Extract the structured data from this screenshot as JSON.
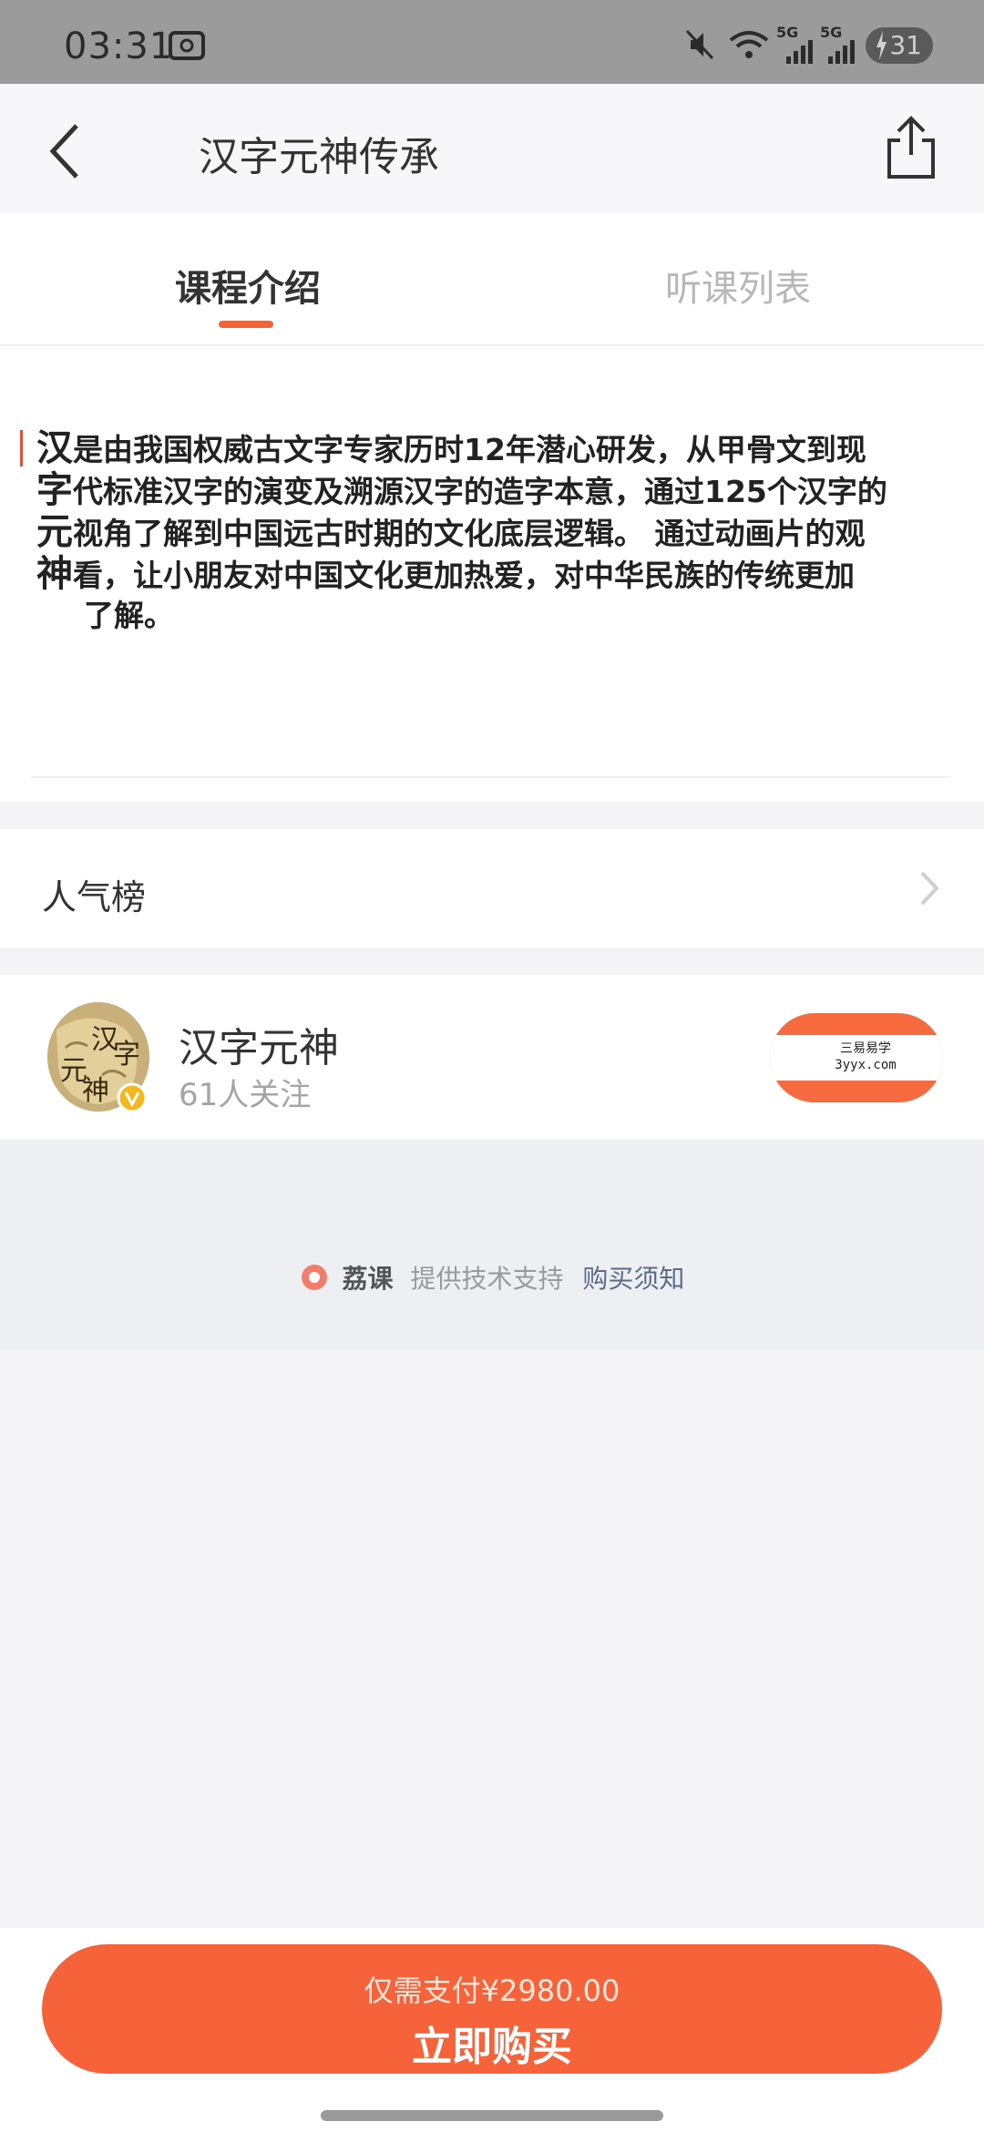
{
  "status_bar": {
    "time": "03:31",
    "signal_5g_a": "5G",
    "signal_5g_b": "5G",
    "battery": "31"
  },
  "nav": {
    "title": "汉字元神传承"
  },
  "tabs": [
    {
      "label": "课程介绍",
      "active": true
    },
    {
      "label": "听课列表",
      "active": false
    }
  ],
  "description": {
    "big_chars": [
      "汉",
      "字",
      "元",
      "神"
    ],
    "lines": [
      "是由我国权威古文字专家历时12年潜心研发，从甲骨文到现",
      "代标准汉字的演变及溯源汉字的造字本意，通过125个汉字的",
      "视角了解到中国远古时期的文化底层逻辑。 通过动画片的观",
      "看，让小朋友对中国文化更加热爱，对中华民族的传统更加",
      "了解。"
    ]
  },
  "popularity": {
    "label": "人气榜"
  },
  "author": {
    "name": "汉字元神",
    "followers": "61人关注",
    "avatar_text": [
      "汉",
      "字",
      "元",
      "神"
    ],
    "watermark_line1": "三易易学",
    "watermark_line2": "3yyx.com"
  },
  "support": {
    "brand": "荔课",
    "text": "提供技术支持",
    "notice": "购买须知"
  },
  "purchase": {
    "price_text": "仅需支付¥2980.00",
    "button_label": "立即购买"
  },
  "colors": {
    "accent": "#f6623a",
    "tab_indicator": "#f0643a",
    "status_bar": "#9b9b9b"
  }
}
